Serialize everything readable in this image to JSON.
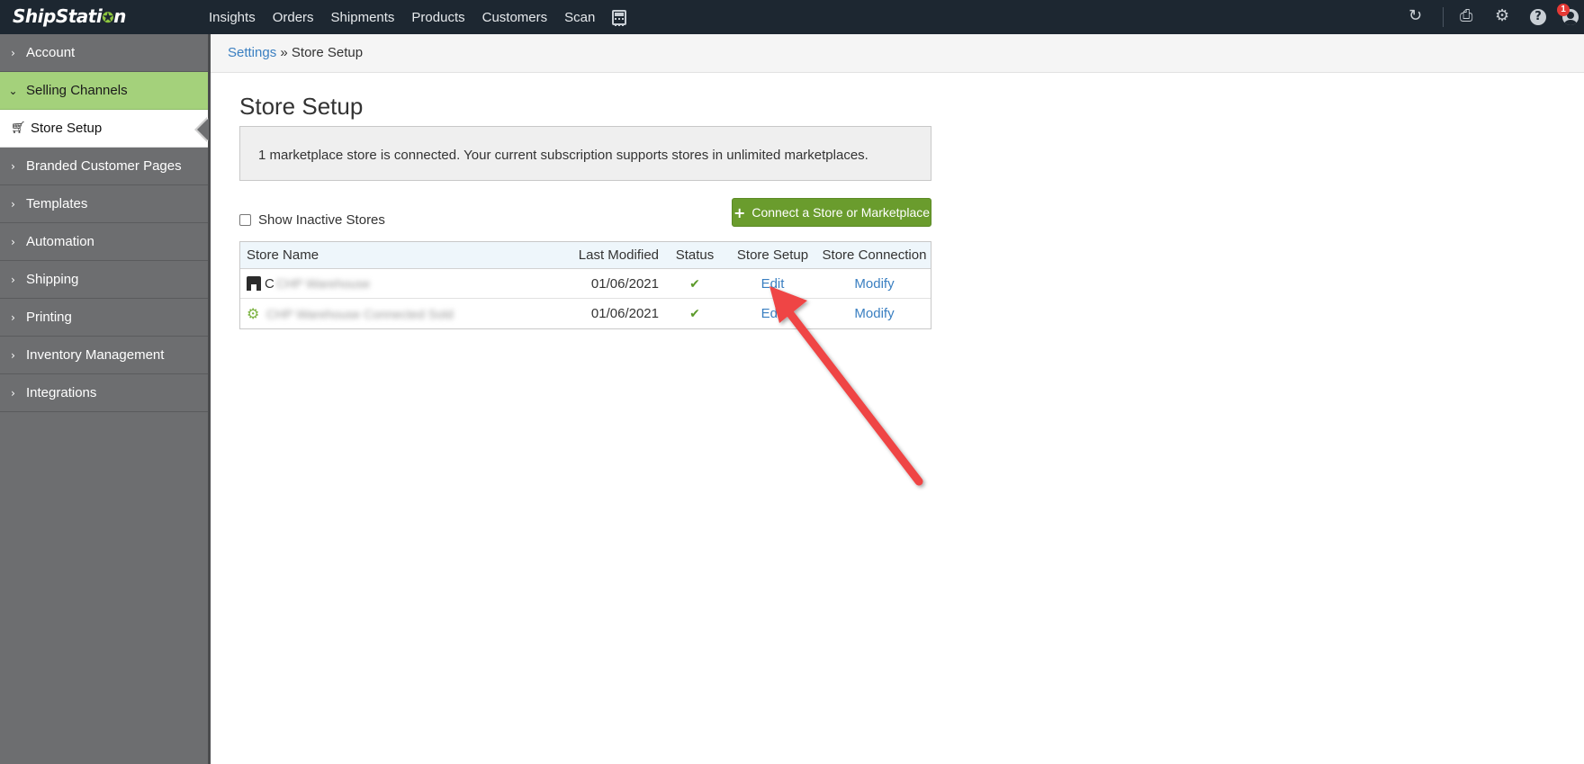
{
  "app": {
    "logo": "ShipStation"
  },
  "topnav": {
    "items": [
      "Insights",
      "Orders",
      "Shipments",
      "Products",
      "Customers",
      "Scan"
    ],
    "notification_count": "1"
  },
  "sidebar": {
    "items": [
      {
        "label": "Account",
        "state": "collapsed"
      },
      {
        "label": "Selling Channels",
        "state": "expanded"
      },
      {
        "label": "Store Setup",
        "state": "selected-subitem"
      },
      {
        "label": "Branded Customer Pages",
        "state": "collapsed"
      },
      {
        "label": "Templates",
        "state": "collapsed"
      },
      {
        "label": "Automation",
        "state": "collapsed"
      },
      {
        "label": "Shipping",
        "state": "collapsed"
      },
      {
        "label": "Printing",
        "state": "collapsed"
      },
      {
        "label": "Inventory Management",
        "state": "collapsed"
      },
      {
        "label": "Integrations",
        "state": "collapsed"
      }
    ]
  },
  "breadcrumb": {
    "parent": "Settings",
    "separator": "»",
    "current": "Store Setup"
  },
  "main": {
    "title": "Store Setup",
    "notice": "1 marketplace store is connected. Your current subscription supports stores in unlimited marketplaces.",
    "show_inactive_label": "Show Inactive Stores",
    "show_inactive_checked": false,
    "connect_button": "Connect a Store or Marketplace"
  },
  "table": {
    "columns": [
      "Store Name",
      "Last Modified",
      "Status",
      "Store Setup",
      "Store Connection"
    ],
    "rows": [
      {
        "icon": "storefront-icon",
        "name_visible": "C",
        "name_blurred": "CHP Warehouse",
        "last_modified": "01/06/2021",
        "status": "active",
        "setup": "Edit",
        "connection": "Modify"
      },
      {
        "icon": "manual-store-gear-icon",
        "name_visible": "",
        "name_blurred": "CHP Warehouse Connected Sold",
        "last_modified": "01/06/2021",
        "status": "active",
        "setup": "Edit",
        "connection": "Modify"
      }
    ]
  },
  "colors": {
    "topbar": "#1d2731",
    "sidebar": "#6d6e70",
    "sidebar_active": "#a4d17b",
    "link": "#3a7fc1",
    "button_green": "#6a9c2d",
    "annotation_arrow": "#ef4444"
  }
}
